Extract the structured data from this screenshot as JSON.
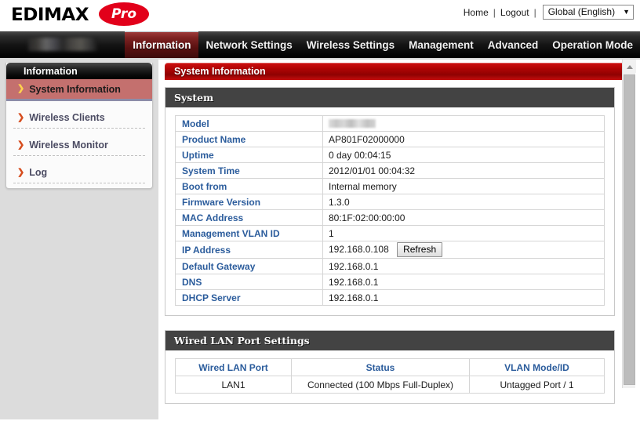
{
  "header": {
    "logo_text": "EDIMAX",
    "logo_badge": "Pro",
    "home_label": "Home",
    "logout_label": "Logout",
    "separator": "|",
    "language_selected": "Global (English)",
    "language_caret": "▼"
  },
  "nav": {
    "brand_redacted": true,
    "items": [
      {
        "label": "Information",
        "active": true
      },
      {
        "label": "Network Settings",
        "active": false
      },
      {
        "label": "Wireless Settings",
        "active": false
      },
      {
        "label": "Management",
        "active": false
      },
      {
        "label": "Advanced",
        "active": false
      },
      {
        "label": "Operation Mode",
        "active": false
      }
    ]
  },
  "sidebar": {
    "title": "Information",
    "items": [
      {
        "label": "System Information",
        "active": true
      },
      {
        "label": "Wireless Clients",
        "active": false
      },
      {
        "label": "Wireless Monitor",
        "active": false
      },
      {
        "label": "Log",
        "active": false
      }
    ],
    "arrow_glyph": "❯"
  },
  "main": {
    "page_title": "System Information",
    "system_panel": {
      "title": "System",
      "rows": [
        {
          "key": "Model",
          "value": "",
          "redacted": true
        },
        {
          "key": "Product Name",
          "value": "AP801F02000000"
        },
        {
          "key": "Uptime",
          "value": " 0 day 00:04:15"
        },
        {
          "key": "System Time",
          "value": "2012/01/01 00:04:32"
        },
        {
          "key": "Boot from",
          "value": "Internal memory"
        },
        {
          "key": "Firmware Version",
          "value": "1.3.0"
        },
        {
          "key": "MAC Address",
          "value": "80:1F:02:00:00:00"
        },
        {
          "key": "Management VLAN ID",
          "value": "1"
        },
        {
          "key": "IP Address",
          "value": "192.168.0.108",
          "button": "Refresh"
        },
        {
          "key": "Default Gateway",
          "value": "192.168.0.1"
        },
        {
          "key": "DNS",
          "value": "192.168.0.1"
        },
        {
          "key": "DHCP Server",
          "value": "192.168.0.1"
        }
      ]
    },
    "lan_panel": {
      "title": "Wired LAN Port Settings",
      "headers": [
        "Wired LAN Port",
        "Status",
        "VLAN Mode/ID"
      ],
      "rows": [
        [
          "LAN1",
          "Connected (100 Mbps Full-Duplex)",
          "Untagged Port /  1"
        ]
      ]
    }
  },
  "scrollbar": {
    "up_arrow": "▲"
  }
}
